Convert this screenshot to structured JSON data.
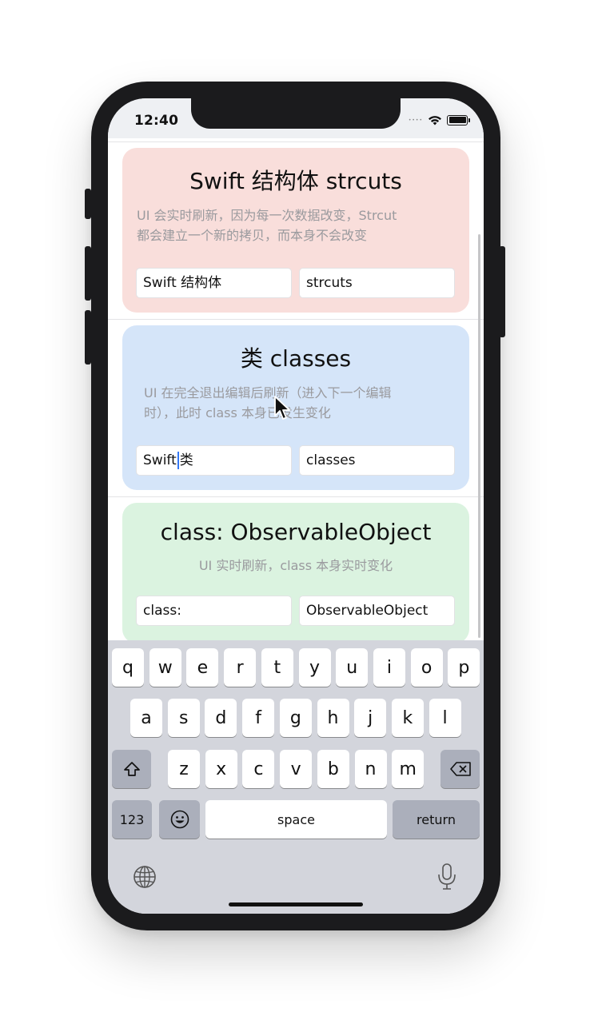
{
  "status_bar": {
    "time": "12:40"
  },
  "cards": [
    {
      "title": "Swift 结构体 strcuts",
      "description_lines": [
        "UI 会实时刷新，因为每一次数据改变，Strcut",
        "都会建立一个新的拷贝，而本身不会改变"
      ],
      "fields": [
        "Swift 结构体",
        "strcuts"
      ],
      "color": "#f9dedb"
    },
    {
      "title": "类 classes",
      "description_lines": [
        "UI 在完全退出编辑后刷新（进入下一个编辑",
        "时），此时 class 本身已发生变化"
      ],
      "fields": [
        "Swift",
        "类",
        "classes"
      ],
      "color": "#d5e5f9"
    },
    {
      "title": "class: ObservableObject",
      "description_lines": [
        "UI 实时刷新，class 本身实时变化"
      ],
      "fields": [
        "class:",
        "ObservableObject"
      ],
      "color": "#dbf3e0"
    }
  ],
  "keyboard": {
    "row1": [
      "q",
      "w",
      "e",
      "r",
      "t",
      "y",
      "u",
      "i",
      "o",
      "p"
    ],
    "row2": [
      "a",
      "s",
      "d",
      "f",
      "g",
      "h",
      "j",
      "k",
      "l"
    ],
    "row3": [
      "z",
      "x",
      "c",
      "v",
      "b",
      "n",
      "m"
    ],
    "numbers_label": "123",
    "space_label": "space",
    "return_label": "return",
    "icons": [
      "shift-icon",
      "delete-icon",
      "emoji-icon",
      "globe-icon",
      "microphone-icon"
    ]
  },
  "colors": {
    "accent": "#3478f6",
    "keyboard_bg": "#d3d5dc",
    "dark_key": "#abafbb"
  }
}
